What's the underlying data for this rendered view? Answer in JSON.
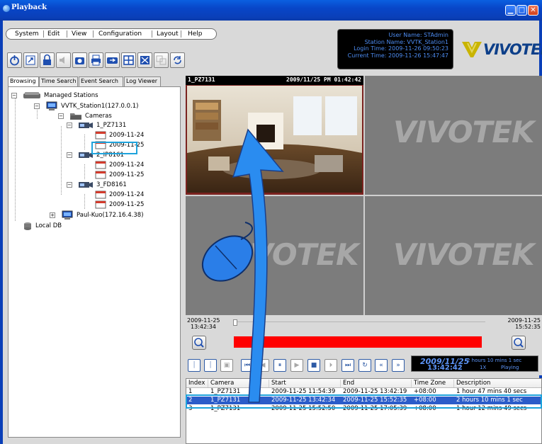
{
  "window": {
    "title": "Playback"
  },
  "menu": {
    "items": [
      "System",
      "Edit",
      "View",
      "Configuration",
      "Layout",
      "Help"
    ]
  },
  "toolbar": {
    "buttons": [
      {
        "name": "power-icon"
      },
      {
        "name": "export-icon"
      },
      {
        "name": "lock-icon"
      },
      {
        "name": "volume-icon"
      },
      {
        "name": "snapshot-icon"
      },
      {
        "name": "print-icon"
      },
      {
        "name": "stream-icon"
      },
      {
        "name": "layout-icon"
      },
      {
        "name": "fullscreen-icon"
      },
      {
        "name": "sync-view-icon"
      },
      {
        "name": "refresh-icon"
      }
    ]
  },
  "user_info": {
    "user_name": "User Name: STAdmin",
    "station_name": "Station Name: VVTK_Station1",
    "login_time": "Login Time: 2009-11-26 09:50:23",
    "current_time": "Current Time: 2009-11-26 15:47:47"
  },
  "logo": {
    "text": "VIVOTEK"
  },
  "left_tabs": [
    "Browsing",
    "Time Search",
    "Event Search",
    "Log Viewer"
  ],
  "tree": {
    "root": "Managed Stations",
    "station": "VVTK_Station1(127.0.0.1)",
    "cameras_label": "Cameras",
    "cameras": [
      {
        "name": "1_PZ7131",
        "dates": [
          "2009-11-24",
          "2009-11-25"
        ]
      },
      {
        "name": "2_IP8161",
        "dates": [
          "2009-11-24",
          "2009-11-25"
        ]
      },
      {
        "name": "3_FD8161",
        "dates": [
          "2009-11-24",
          "2009-11-25"
        ]
      }
    ],
    "other_station": "Paul-Kuo(172.16.4.38)",
    "local_db": "Local DB"
  },
  "video": {
    "main_camera": "1_PZ7131",
    "main_timestamp": "2009/11/25 PM 01:42:42",
    "watermark": "VIVOTEK"
  },
  "timeline": {
    "start_date": "2009-11-25",
    "start_time": "13:42:34",
    "end_date": "2009-11-25",
    "end_time": "15:52:35"
  },
  "clock": {
    "date": "2009/11/25",
    "time": "13:42:42",
    "duration": "2 hours 10 mins 1 sec",
    "speed": "1X",
    "status": "Playing"
  },
  "table": {
    "headers": [
      "Index",
      "Camera",
      "Start",
      "End",
      "Time Zone",
      "Description"
    ],
    "rows": [
      [
        "1",
        "1_PZ7131",
        "2009-11-25 11:54:39",
        "2009-11-25 13:42:19",
        "+08:00",
        "1 hour 47 mins 40 secs"
      ],
      [
        "2",
        "1_PZ7131",
        "2009-11-25 13:42:34",
        "2009-11-25 15:52:35",
        "+08:00",
        "2 hours 10 mins 1 sec"
      ],
      [
        "3",
        "1_PZ7131",
        "2009-11-25 15:52:50",
        "2009-11-25 17:05:39",
        "+08:00",
        "1 hour 12 mins 49 secs"
      ]
    ]
  },
  "colors": {
    "titlebar": "#0a46c8",
    "highlight": "#1ea3dc",
    "arrow": "#2a8cf0",
    "redbar": "#ff0000",
    "selected_row": "#2b5cc9",
    "clock_text": "#5d95f8"
  }
}
